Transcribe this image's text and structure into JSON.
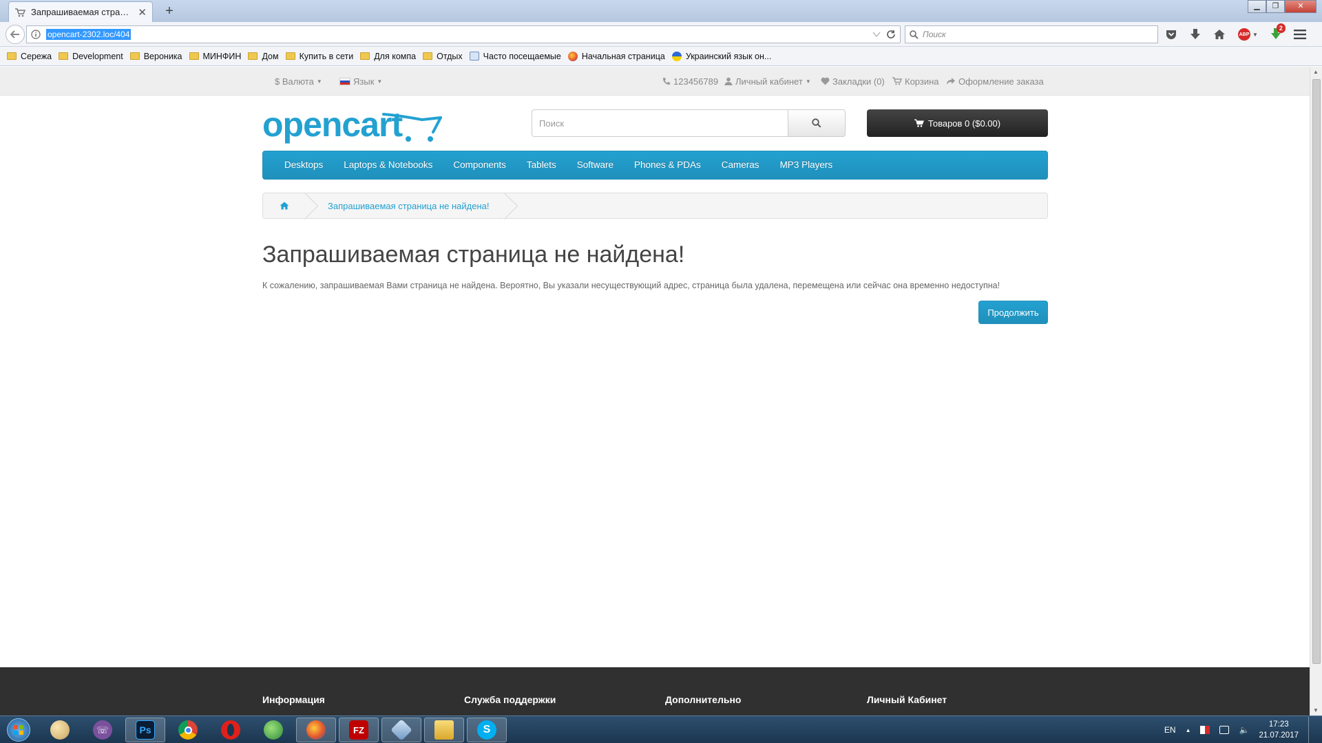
{
  "browser": {
    "tab_title": "Запрашиваемая страниц...",
    "url": "opencart-2302.loc/404",
    "search_placeholder": "Поиск",
    "addon_badge": "ABP",
    "download_badge": "2"
  },
  "bookmarks": [
    {
      "label": "Сережа",
      "type": "folder"
    },
    {
      "label": "Development",
      "type": "folder"
    },
    {
      "label": "Вероника",
      "type": "folder"
    },
    {
      "label": "МИНФИН",
      "type": "folder"
    },
    {
      "label": "Дом",
      "type": "folder"
    },
    {
      "label": "Купить в сети",
      "type": "folder"
    },
    {
      "label": "Для компа",
      "type": "folder"
    },
    {
      "label": "Отдых",
      "type": "folder"
    },
    {
      "label": "Часто посещаемые",
      "type": "smart"
    },
    {
      "label": "Начальная страница",
      "type": "firefox"
    },
    {
      "label": "Украинский язык он...",
      "type": "ua"
    }
  ],
  "store": {
    "topbar": {
      "currency": "$ Валюта",
      "language": "Язык",
      "phone": "123456789",
      "account": "Личный кабинет",
      "wishlist": "Закладки (0)",
      "cart": "Корзина",
      "checkout": "Оформление заказа"
    },
    "logo_text": "opencart",
    "search_placeholder": "Поиск",
    "cart_button": "Товаров 0 ($0.00)",
    "menu": [
      "Desktops",
      "Laptops & Notebooks",
      "Components",
      "Tablets",
      "Software",
      "Phones & PDAs",
      "Cameras",
      "MP3 Players"
    ],
    "breadcrumb": "Запрашиваемая страница не найдена!",
    "title": "Запрашиваемая страница не найдена!",
    "text": "К сожалению, запрашиваемая Вами страница не найдена. Вероятно, Вы указали несуществующий адрес, страница была удалена, перемещена или сейчас она временно недоступна!",
    "continue_button": "Продолжить",
    "footer": [
      "Информация",
      "Служба поддержки",
      "Дополнительно",
      "Личный Кабинет"
    ]
  },
  "taskbar": {
    "apps": [
      "paint",
      "viber",
      "photoshop",
      "chrome",
      "opera",
      "earth",
      "firefox",
      "filezilla",
      "virtualbox",
      "explorer",
      "skype"
    ],
    "ps_label": "Ps",
    "fz_label": "FZ",
    "skype_label": "S",
    "lang": "EN",
    "time": "17:23",
    "date": "21.07.2017"
  },
  "colors": {
    "accent": "#23a1d1",
    "cart_dark": "#222222",
    "footer": "#303030"
  }
}
